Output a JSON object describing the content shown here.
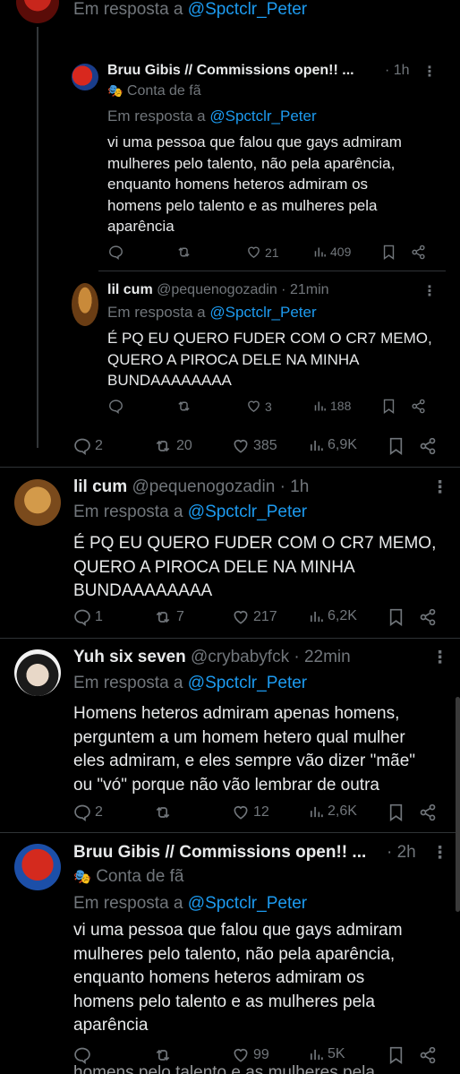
{
  "top_partial": {
    "reply_prefix": "Em resposta a",
    "reply_handle": "@Spctclr_Peter"
  },
  "t1": {
    "name": "Bruu Gibis // Commissions open!! ...",
    "time": "· 1h",
    "badge": "Conta de fã",
    "reply_prefix": "Em resposta a",
    "reply_handle": "@Spctclr_Peter",
    "text": "vi uma pessoa que falou que gays admiram\nmulheres pelo talento, não pela aparência,\nenquanto homens heteros admiram os\nhomens pelo talento e as mulheres pela\naparência",
    "likes": "21",
    "views": "409"
  },
  "t2": {
    "name": "lil cum",
    "handle": "@pequenogozadin",
    "time": "· 21min",
    "reply_prefix": "Em resposta a",
    "reply_handle": "@Spctclr_Peter",
    "text": "É PQ EU QUERO FUDER COM O CR7 MEMO,\nQUERO A PIROCA DELE NA MINHA\nBUNDAAAAAAAA",
    "likes": "3",
    "views": "188"
  },
  "t2_parent_actions": {
    "replies": "2",
    "retweets": "20",
    "likes": "385",
    "views": "6,9K"
  },
  "t3": {
    "name": "lil cum",
    "handle": "@pequenogozadin",
    "time": "· 1h",
    "reply_prefix": "Em resposta a",
    "reply_handle": "@Spctclr_Peter",
    "text": "É PQ EU QUERO FUDER COM O CR7 MEMO,\nQUERO A PIROCA DELE NA MINHA\nBUNDAAAAAAAA",
    "replies": "1",
    "retweets": "7",
    "likes": "217",
    "views": "6,2K"
  },
  "t4": {
    "name": "Yuh six seven",
    "handle": "@crybabyfck",
    "time": "· 22min",
    "reply_prefix": "Em resposta a",
    "reply_handle": "@Spctclr_Peter",
    "text": "Homens heteros admiram apenas homens,\nperguntem a um homem hetero qual mulher\neles admiram, e eles sempre vão dizer \"mãe\"\nou \"vó\" porque não vão lembrar de outra",
    "replies": "2",
    "likes": "12",
    "views": "2,6K"
  },
  "t5": {
    "name": "Bruu Gibis // Commissions open!! ...",
    "time": "· 2h",
    "badge": "Conta de fã",
    "reply_prefix": "Em resposta a",
    "reply_handle": "@Spctclr_Peter",
    "text": "vi uma pessoa que falou que gays admiram\nmulheres pelo talento, não pela aparência,\nenquanto homens heteros admiram os\nhomens pelo talento e as mulheres pela\naparência",
    "likes": "99",
    "views": "5K"
  },
  "bottom_partial": {
    "text": "homens pelo talento e as mulheres pela"
  },
  "colors": {
    "bg": "#000000",
    "text": "#e7e9ea",
    "muted": "#71767b",
    "link": "#1d9bf0",
    "divider": "#2f3336"
  }
}
